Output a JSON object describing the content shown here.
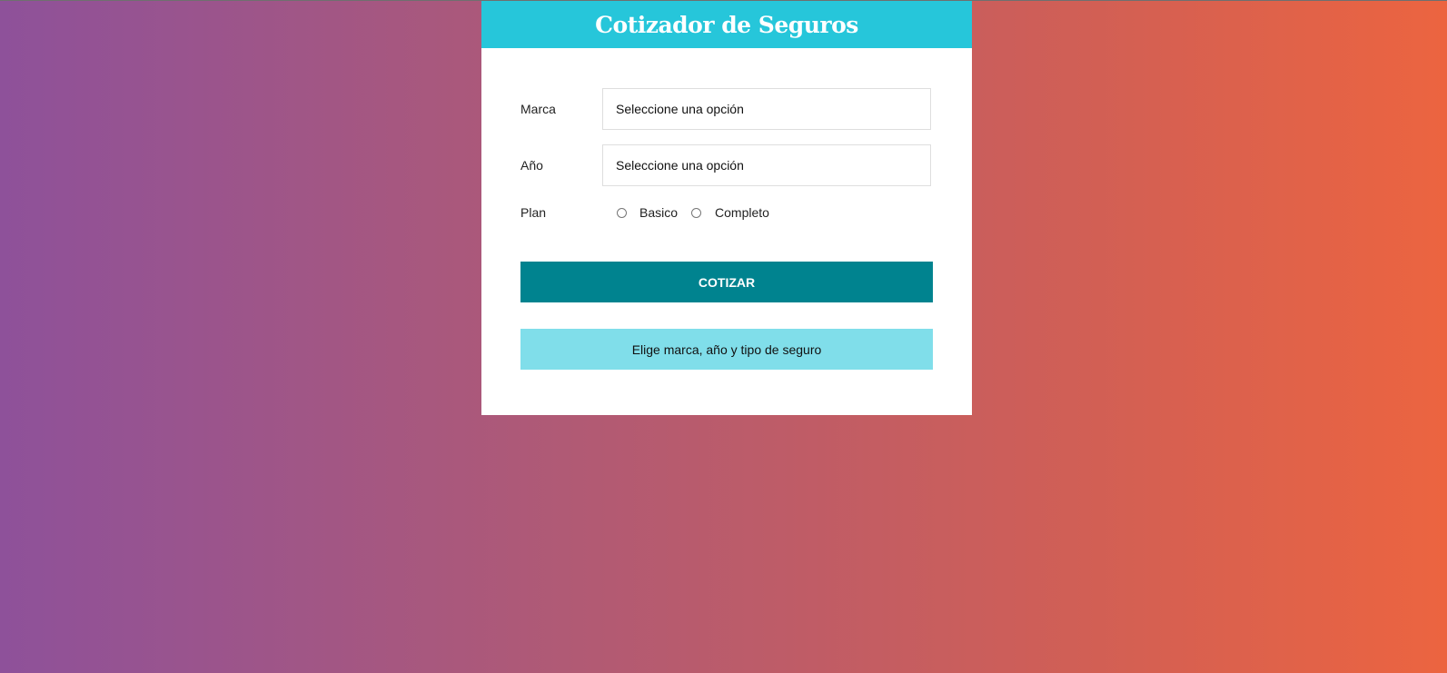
{
  "header": {
    "title": "Cotizador de Seguros"
  },
  "form": {
    "marca": {
      "label": "Marca",
      "selected": "Seleccione una opción"
    },
    "ano": {
      "label": "Año",
      "selected": "Seleccione una opción"
    },
    "plan": {
      "label": "Plan",
      "options": [
        "Basico",
        "Completo"
      ]
    },
    "submit_label": "COTIZAR"
  },
  "message": {
    "text": "Elige marca, año y tipo de seguro"
  },
  "colors": {
    "header_bg": "#26c6da",
    "button_bg": "#00838f",
    "message_bg": "#80deea",
    "gradient_start": "#8e519a",
    "gradient_end": "#ec6440"
  }
}
